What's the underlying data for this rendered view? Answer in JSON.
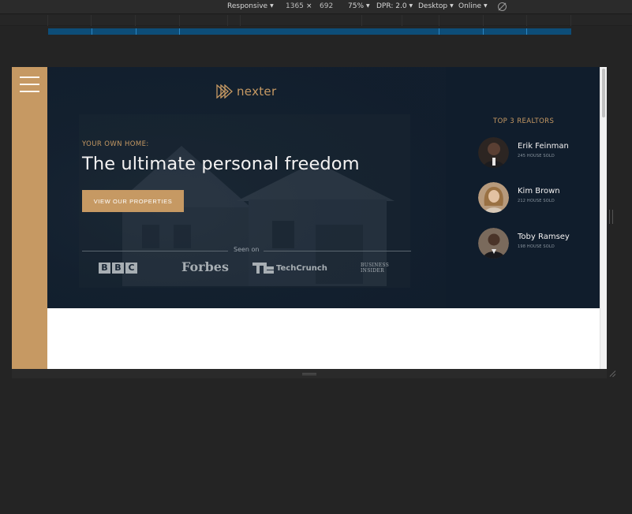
{
  "devtools": {
    "device_mode": "Responsive",
    "width": "1365",
    "times": "×",
    "height": "692",
    "zoom": "75%",
    "dpr": "DPR: 2.0",
    "ua": "Desktop",
    "network": "Online",
    "rotate_icon": "rotate-icon"
  },
  "page": {
    "logo": "nexter",
    "eyebrow": "YOUR OWN HOME:",
    "headline": "The ultimate personal freedom",
    "cta": "VIEW OUR PROPERTIES",
    "seen_on": "Seen on",
    "brands": {
      "bbc": [
        "B",
        "B",
        "C"
      ],
      "forbes": "Forbes",
      "techcrunch": "TechCrunch",
      "business_insider_1": "BUSINESS",
      "business_insider_2": "INSIDER"
    },
    "realtors_title": "TOP 3 REALTORS",
    "realtors": [
      {
        "name": "Erik Feinman",
        "sold": "245 HOUSE SOLD"
      },
      {
        "name": "Kim Brown",
        "sold": "212 HOUSE SOLD"
      },
      {
        "name": "Toby Ramsey",
        "sold": "198 HOUSE SOLD"
      }
    ]
  },
  "colors": {
    "accent": "#c69963",
    "dark": "#101d2c",
    "devtools_bg": "#242424"
  }
}
